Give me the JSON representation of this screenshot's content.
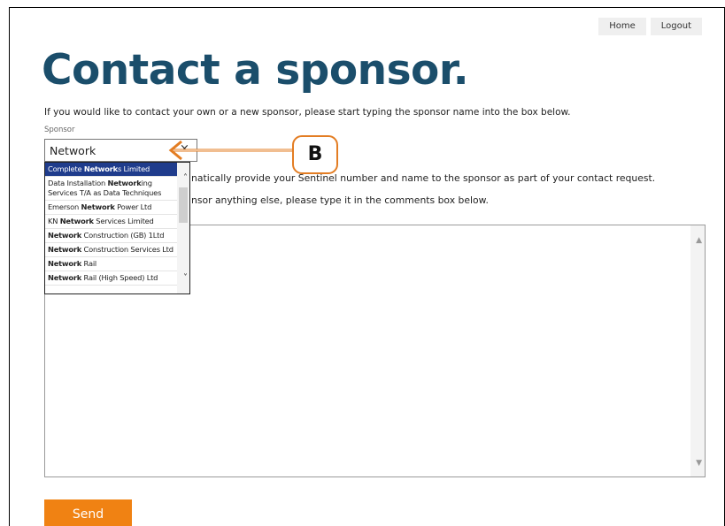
{
  "nav": {
    "home_label": "Home",
    "logout_label": "Logout"
  },
  "page": {
    "title": "Contact a sponsor.",
    "intro": "If you would like to contact your own or a new sponsor, please start typing the sponsor name into the box below."
  },
  "sponsor": {
    "label": "Sponsor",
    "value": "Network",
    "clear_symbol": "×"
  },
  "body": {
    "line1": "natically provide your Sentinel number and name to the sponsor as part of your contact request.",
    "line2": "nsor anything else, please type it in the comments box below."
  },
  "dropdown": {
    "items": [
      {
        "pre": "Complete ",
        "match": "Network",
        "post": "s Limited",
        "selected": true
      },
      {
        "pre": "Data Installation ",
        "match": "Network",
        "post": "ing Services T/A as Data Techniques"
      },
      {
        "pre": "Emerson ",
        "match": "Network",
        "post": " Power Ltd"
      },
      {
        "pre": "KN ",
        "match": "Network",
        "post": " Services Limited"
      },
      {
        "pre": "",
        "match": "Network",
        "post": " Construction (GB) 1Ltd"
      },
      {
        "pre": "",
        "match": "Network",
        "post": " Construction Services Ltd"
      },
      {
        "pre": "",
        "match": "Network",
        "post": " Rail"
      },
      {
        "pre": "",
        "match": "Network",
        "post": " Rail (High Speed) Ltd"
      }
    ]
  },
  "annotation": {
    "badge_label": "B",
    "color": "#e37d23"
  },
  "actions": {
    "send_label": "Send"
  },
  "colors": {
    "title": "#1b4e6b",
    "accent": "#f08213",
    "selection": "#1f3c8c"
  }
}
